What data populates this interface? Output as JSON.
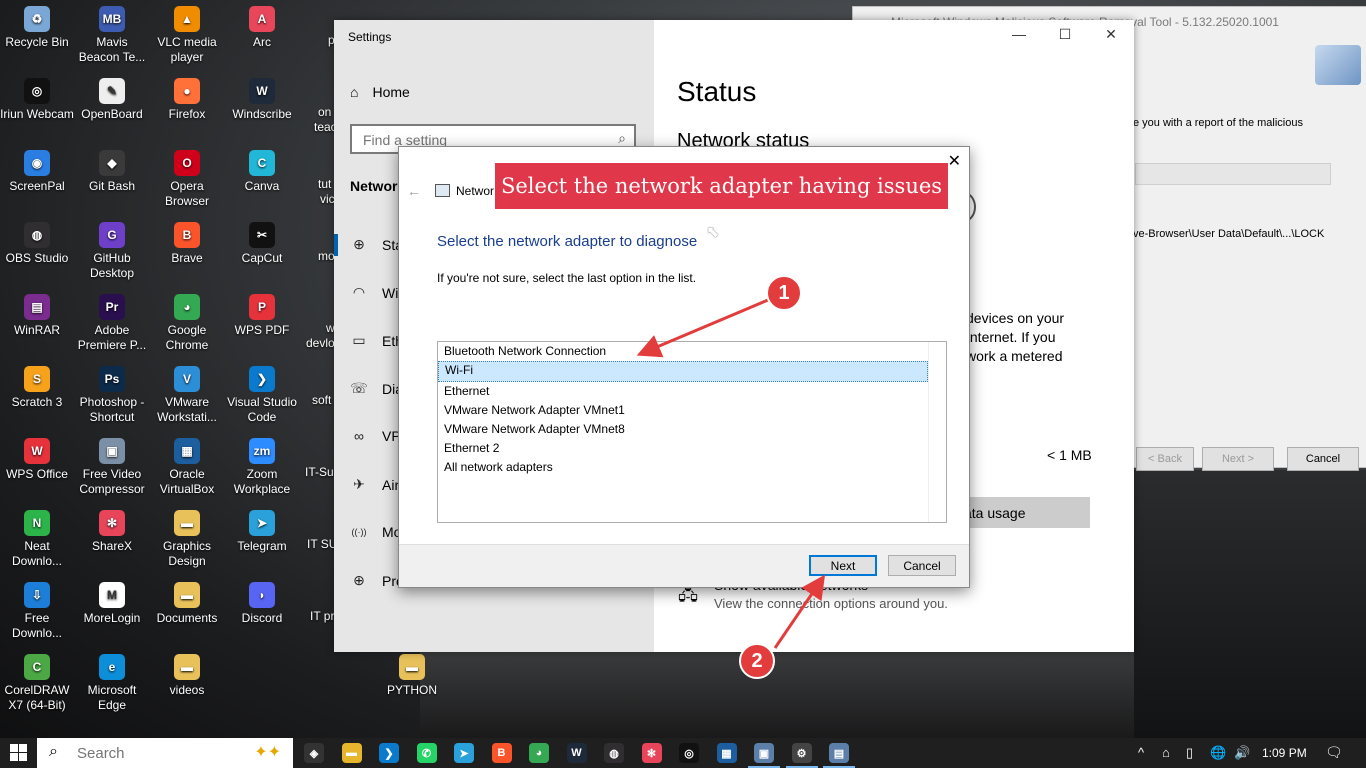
{
  "desktop": {
    "icons": [
      {
        "label": "Recycle Bin",
        "icon": "recycle-bin-icon",
        "color": "#7aa7d6",
        "sym": "♻"
      },
      {
        "label": "Mavis Beacon Te...",
        "icon": "mavis-beacon-icon",
        "color": "#3d5bb0",
        "sym": "MB"
      },
      {
        "label": "VLC media player",
        "icon": "vlc-cone-icon",
        "color": "#f08c00",
        "sym": "▲"
      },
      {
        "label": "Arc",
        "icon": "arc-icon",
        "color": "#e8465a",
        "sym": "A"
      },
      {
        "label": "Iriun Webcam",
        "icon": "iriun-webcam-icon",
        "color": "#111111",
        "sym": "◎"
      },
      {
        "label": "OpenBoard",
        "icon": "openboard-icon",
        "color": "#eeeeee",
        "sym": "✎"
      },
      {
        "label": "Firefox",
        "icon": "firefox-icon",
        "color": "#ff7139",
        "sym": "●"
      },
      {
        "label": "Windscribe",
        "icon": "windscribe-icon",
        "color": "#1e2a3a",
        "sym": "W"
      },
      {
        "label": "ScreenPal",
        "icon": "screenpal-icon",
        "color": "#2a7de1",
        "sym": "◉"
      },
      {
        "label": "Git Bash",
        "icon": "git-bash-icon",
        "color": "#3a3a3a",
        "sym": "◆"
      },
      {
        "label": "Opera Browser",
        "icon": "opera-icon",
        "color": "#d0021b",
        "sym": "O"
      },
      {
        "label": "Canva",
        "icon": "canva-icon",
        "color": "#22b7d7",
        "sym": "C"
      },
      {
        "label": "OBS Studio",
        "icon": "obs-icon",
        "color": "#302e31",
        "sym": "◍"
      },
      {
        "label": "GitHub Desktop",
        "icon": "github-desktop-icon",
        "color": "#6e40c9",
        "sym": "G"
      },
      {
        "label": "Brave",
        "icon": "brave-icon",
        "color": "#fb542b",
        "sym": "B"
      },
      {
        "label": "CapCut",
        "icon": "capcut-icon",
        "color": "#111111",
        "sym": "✂"
      },
      {
        "label": "WinRAR",
        "icon": "winrar-icon",
        "color": "#7a2c8f",
        "sym": "▤"
      },
      {
        "label": "Adobe Premiere P...",
        "icon": "premiere-pro-icon",
        "color": "#2a0f4f",
        "sym": "Pr"
      },
      {
        "label": "Google Chrome",
        "icon": "chrome-icon",
        "color": "#34a853",
        "sym": "◕"
      },
      {
        "label": "WPS PDF",
        "icon": "wps-pdf-icon",
        "color": "#e5323b",
        "sym": "P"
      },
      {
        "label": "Scratch 3",
        "icon": "scratch-icon",
        "color": "#f7a21b",
        "sym": "S"
      },
      {
        "label": "Photoshop - Shortcut",
        "icon": "photoshop-icon",
        "color": "#0c2a4a",
        "sym": "Ps"
      },
      {
        "label": "VMware Workstati...",
        "icon": "vmware-icon",
        "color": "#2c8ed6",
        "sym": "V"
      },
      {
        "label": "Visual Studio Code",
        "icon": "vscode-icon",
        "color": "#0a7acc",
        "sym": "❯"
      },
      {
        "label": "WPS Office",
        "icon": "wps-office-icon",
        "color": "#e5323b",
        "sym": "W"
      },
      {
        "label": "Free Video Compressor",
        "icon": "video-compressor-icon",
        "color": "#7b8fa6",
        "sym": "▣"
      },
      {
        "label": "Oracle VirtualBox",
        "icon": "virtualbox-icon",
        "color": "#1c5e9e",
        "sym": "▦"
      },
      {
        "label": "Zoom Workplace",
        "icon": "zoom-icon",
        "color": "#2d8cff",
        "sym": "zm"
      },
      {
        "label": "Neat Downlo...",
        "icon": "neat-download-icon",
        "color": "#2cb34a",
        "sym": "N"
      },
      {
        "label": "ShareX",
        "icon": "sharex-icon",
        "color": "#e8445a",
        "sym": "✻"
      },
      {
        "label": "Graphics Design",
        "icon": "folder-icon",
        "color": "#e8c15a",
        "sym": "▬"
      },
      {
        "label": "Telegram",
        "icon": "telegram-icon",
        "color": "#2aa1da",
        "sym": "➤"
      },
      {
        "label": "Free Downlo...",
        "icon": "free-download-icon",
        "color": "#1c7ed6",
        "sym": "⇩"
      },
      {
        "label": "MoreLogin",
        "icon": "morelogin-icon",
        "color": "#ffffff",
        "sym": "M"
      },
      {
        "label": "Documents",
        "icon": "documents-folder-icon",
        "color": "#e8c15a",
        "sym": "▬"
      },
      {
        "label": "Discord",
        "icon": "discord-icon",
        "color": "#5865f2",
        "sym": "◗"
      },
      {
        "label": "CorelDRAW X7 (64-Bit)",
        "icon": "coreldraw-icon",
        "color": "#4ca845",
        "sym": "C"
      },
      {
        "label": "Microsoft Edge",
        "icon": "edge-icon",
        "color": "#0c8ed9",
        "sym": "e"
      },
      {
        "label": "videos",
        "icon": "videos-folder-icon",
        "color": "#e8c15a",
        "sym": "▬"
      },
      {
        "label": "PYTHON",
        "icon": "python-folder-icon",
        "color": "#e8c15a",
        "sym": "▬"
      }
    ],
    "partial_labels": [
      "p",
      "on",
      "teac",
      "tut",
      "vic",
      "mo",
      "w",
      "devlo",
      "soft",
      "IT-Su",
      "IT SU",
      "IT pr"
    ]
  },
  "msrt": {
    "title": "Microsoft Windows Malicious Software Removal Tool - 5.132.25020.1001",
    "report_text": "e you with a report of the malicious",
    "path_text": "ve-Browser\\User Data\\Default\\...\\LOCK",
    "back_label": "< Back",
    "next_label": "Next >",
    "cancel_label": "Cancel"
  },
  "settings": {
    "window_title": "Settings",
    "home_label": "Home",
    "search_placeholder": "Find a setting",
    "section_label": "Networ",
    "nav": [
      {
        "label": "Sta",
        "icon": "globe-status-icon",
        "sym": "⊕"
      },
      {
        "label": "Wi",
        "icon": "wifi-icon",
        "sym": "◠"
      },
      {
        "label": "Eth",
        "icon": "ethernet-icon",
        "sym": "▭"
      },
      {
        "label": "Dia",
        "icon": "dialup-icon",
        "sym": "☏"
      },
      {
        "label": "VP",
        "icon": "vpn-icon",
        "sym": "∞"
      },
      {
        "label": "Air",
        "icon": "airplane-icon",
        "sym": "✈"
      },
      {
        "label": "Mo",
        "icon": "mobile-hotspot-icon",
        "sym": "((·))"
      },
      {
        "label": "Pro",
        "icon": "proxy-icon",
        "sym": "⊕"
      }
    ],
    "status_title": "Status",
    "network_status_heading": "Network status",
    "metered_lines": [
      "devices on your",
      "Internet. If you",
      "work a metered"
    ],
    "data_amount": "< 1 MB",
    "data_usage_label": "ata usage",
    "show_networks_label": "Show available networks",
    "show_networks_desc": "View the connection options around you."
  },
  "dialog": {
    "app_title": "Networ",
    "heading": "Select the network adapter to diagnose",
    "subtext": "If you're not sure, select the last option in the list.",
    "adapters": [
      "Bluetooth Network Connection",
      "Wi-Fi",
      "Ethernet",
      "VMware Network Adapter VMnet1",
      "VMware Network Adapter VMnet8",
      "Ethernet 2",
      "All network adapters"
    ],
    "selected_adapter": "Wi-Fi",
    "next_label": "Next",
    "cancel_label": "Cancel",
    "close_glyph": "✕"
  },
  "callout": {
    "text": "Select the network adapter having issues",
    "step1": "1",
    "step2": "2",
    "color": "#e0384a"
  },
  "taskbar": {
    "search_placeholder": "Search",
    "apps": [
      {
        "name": "taskbar-pinned-app-icon",
        "color": "#333",
        "sym": "◈"
      },
      {
        "name": "file-explorer-icon",
        "color": "#e8b62c",
        "sym": "▬"
      },
      {
        "name": "vscode-taskbar-icon",
        "color": "#0a7acc",
        "sym": "❯"
      },
      {
        "name": "whatsapp-icon",
        "color": "#25d366",
        "sym": "✆"
      },
      {
        "name": "telegram-taskbar-icon",
        "color": "#2aa1da",
        "sym": "➤"
      },
      {
        "name": "brave-taskbar-icon",
        "color": "#fb542b",
        "sym": "B"
      },
      {
        "name": "chrome-taskbar-icon",
        "color": "#34a853",
        "sym": "◕"
      },
      {
        "name": "windscribe-taskbar-icon",
        "color": "#1e2a3a",
        "sym": "W"
      },
      {
        "name": "obs-taskbar-icon",
        "color": "#302e31",
        "sym": "◍"
      },
      {
        "name": "sharex-taskbar-icon",
        "color": "#e8445a",
        "sym": "✻"
      },
      {
        "name": "iriun-taskbar-icon",
        "color": "#111",
        "sym": "◎"
      },
      {
        "name": "virtualbox-taskbar-icon",
        "color": "#1c5e9e",
        "sym": "▦"
      },
      {
        "name": "msrt-taskbar-icon",
        "color": "#5b7fa8",
        "sym": "▣"
      },
      {
        "name": "settings-taskbar-icon",
        "color": "#444",
        "sym": "⚙"
      },
      {
        "name": "network-diagnostics-taskbar-icon",
        "color": "#5b7fa8",
        "sym": "▤"
      }
    ],
    "tray": [
      "^",
      "⌂",
      "▯",
      "🌐",
      "🔊"
    ],
    "time": "1:09 PM",
    "accent_color": "#7ab8ee"
  }
}
